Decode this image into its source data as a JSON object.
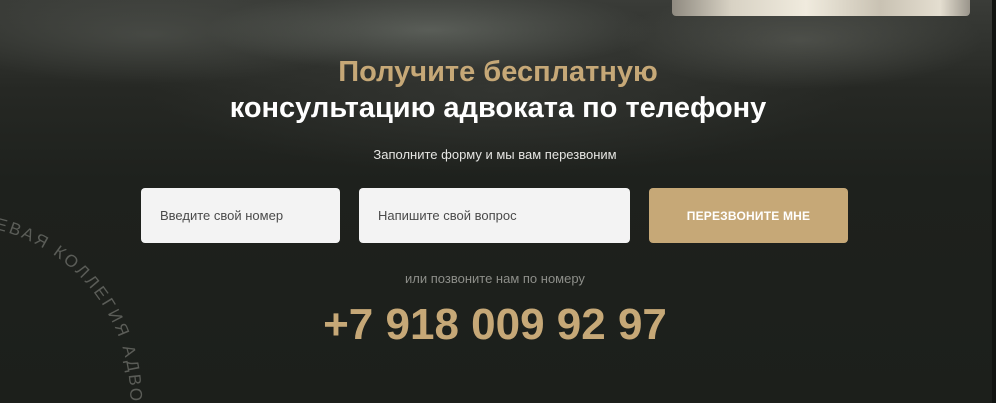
{
  "hero": {
    "title_line1": "Получите бесплатную",
    "title_line2": "консультацию адвоката по телефону",
    "subtitle": "Заполните форму и мы вам перезвоним"
  },
  "form": {
    "phone_placeholder": "Введите свой номер",
    "question_placeholder": "Напишите свой вопрос",
    "submit_label": "ПЕРЕЗВОНИТЕ МНЕ"
  },
  "contact": {
    "or_call_text": "или позвоните нам по номеру",
    "phone": "+7 918 009 92 97"
  },
  "stamp": {
    "text": "РАЕВАЯ КОЛЛЕГИЯ АДВОК"
  },
  "colors": {
    "accent": "#c6a877",
    "background": "#1c1f1b",
    "input_bg": "#f3f3f3"
  }
}
